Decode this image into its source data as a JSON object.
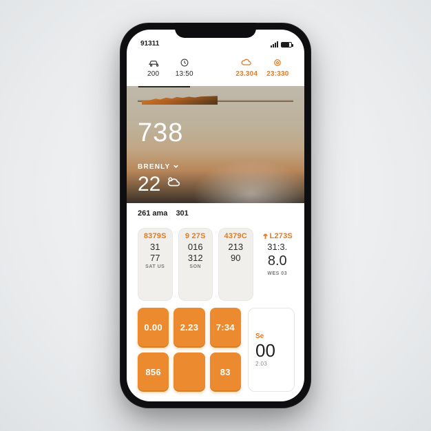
{
  "status": {
    "time": "91311"
  },
  "stats": [
    {
      "icon": "car",
      "value": "200"
    },
    {
      "icon": "clock",
      "value": "13:50"
    },
    {
      "icon": "blank",
      "value": ""
    },
    {
      "icon": "cloud",
      "value": "23.304",
      "accent": true
    },
    {
      "icon": "target",
      "value": "23:330",
      "accent": true
    }
  ],
  "hero": {
    "headline": "738",
    "label": "BRENLY",
    "temperature": "22"
  },
  "mid": {
    "left": "261 ama",
    "right": "301"
  },
  "forecast": [
    {
      "top": "8379S",
      "a": "31",
      "b": "77",
      "lbl": "SAT US"
    },
    {
      "top": "9 27S",
      "a": "016",
      "b": "312",
      "lbl": "SON"
    },
    {
      "top": "4379C",
      "a": "213",
      "b": "90",
      "lbl": ""
    },
    {
      "top": "L273S",
      "a": "31:3.",
      "b": "8.0",
      "lbl": "WES 03",
      "last": true
    }
  ],
  "pad": [
    "0.00",
    "2.23",
    "7:34",
    "856",
    "",
    "83"
  ],
  "readout": {
    "label": "Se",
    "value": "00",
    "sub": "2:03"
  },
  "colors": {
    "accent": "#e67a1f",
    "button": "#eb8a2e"
  }
}
